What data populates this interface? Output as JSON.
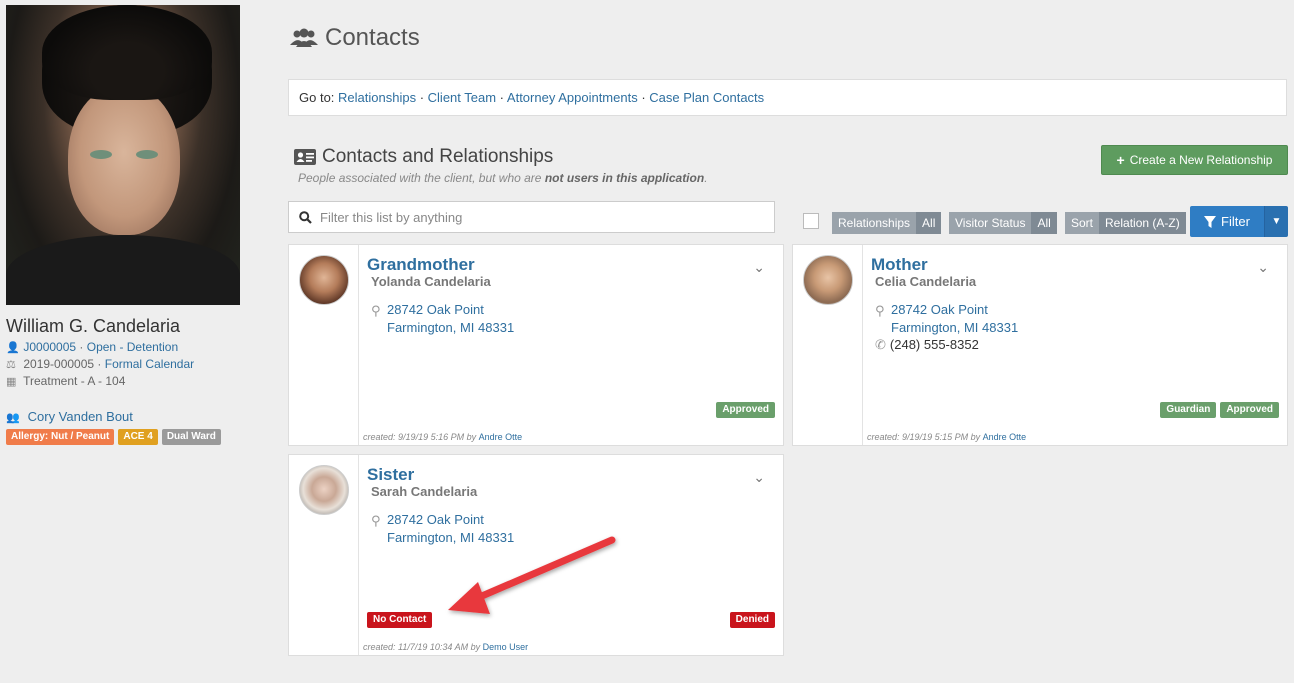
{
  "client": {
    "name": "William G. Candelaria",
    "case_id": "J0000005",
    "case_status": "Open - Detention",
    "court_id": "2019-000005",
    "court_calendar": "Formal Calendar",
    "location": "Treatment - A - 104",
    "worker": "Cory Vanden Bout",
    "tags": [
      {
        "label": "Allergy: Nut / Peanut",
        "color": "#f07c4a"
      },
      {
        "label": "ACE 4",
        "color": "#e0a020"
      },
      {
        "label": "Dual Ward",
        "color": "#9a9a9a"
      }
    ]
  },
  "page": {
    "title": "Contacts",
    "goto_label": "Go to:",
    "goto_links": [
      "Relationships",
      "Client Team",
      "Attorney Appointments",
      "Case Plan Contacts"
    ]
  },
  "section": {
    "title": "Contacts and Relationships",
    "subtitle_pre": "People associated with the client, but who are ",
    "subtitle_bold": "not users in this application",
    "subtitle_post": ".",
    "create_button": "Create a New Relationship",
    "filter_placeholder": "Filter this list by anything"
  },
  "filters": {
    "relationships_label": "Relationships",
    "relationships_value": "All",
    "visitor_label": "Visitor Status",
    "visitor_value": "All",
    "sort_label": "Sort",
    "sort_value": "Relation (A-Z)",
    "filter_button": "Filter"
  },
  "contacts": [
    {
      "relation": "Grandmother",
      "name": "Yolanda Candelaria",
      "address1": "28742 Oak Point",
      "address2": "Farmington, MI 48331",
      "phone": "",
      "badge_left": "",
      "badges": [
        {
          "label": "Approved",
          "color": "#6a9f6b"
        }
      ],
      "created_label": "created:",
      "created_date": "9/19/19 5:16 PM",
      "by_label": "by",
      "created_by": "Andre Otte"
    },
    {
      "relation": "Mother",
      "name": "Celia Candelaria",
      "address1": "28742 Oak Point",
      "address2": "Farmington, MI 48331",
      "phone": "(248) 555-8352",
      "badge_left": "",
      "badges": [
        {
          "label": "Guardian",
          "color": "#6a9f6b"
        },
        {
          "label": "Approved",
          "color": "#6a9f6b"
        }
      ],
      "created_label": "created:",
      "created_date": "9/19/19 5:15 PM",
      "by_label": "by",
      "created_by": "Andre Otte"
    },
    {
      "relation": "Sister",
      "name": "Sarah Candelaria",
      "address1": "28742 Oak Point",
      "address2": "Farmington, MI 48331",
      "phone": "",
      "badge_left": "No Contact",
      "badges": [
        {
          "label": "Denied",
          "color": "#c9141c"
        }
      ],
      "created_label": "created:",
      "created_date": "11/7/19 10:34 AM",
      "by_label": "by",
      "created_by": "Demo User"
    }
  ],
  "colors": {
    "link": "#2f6f9f",
    "create_button": "#5e9c5f",
    "filter_button": "#2f7dc4",
    "arrow": "#e8383d"
  }
}
